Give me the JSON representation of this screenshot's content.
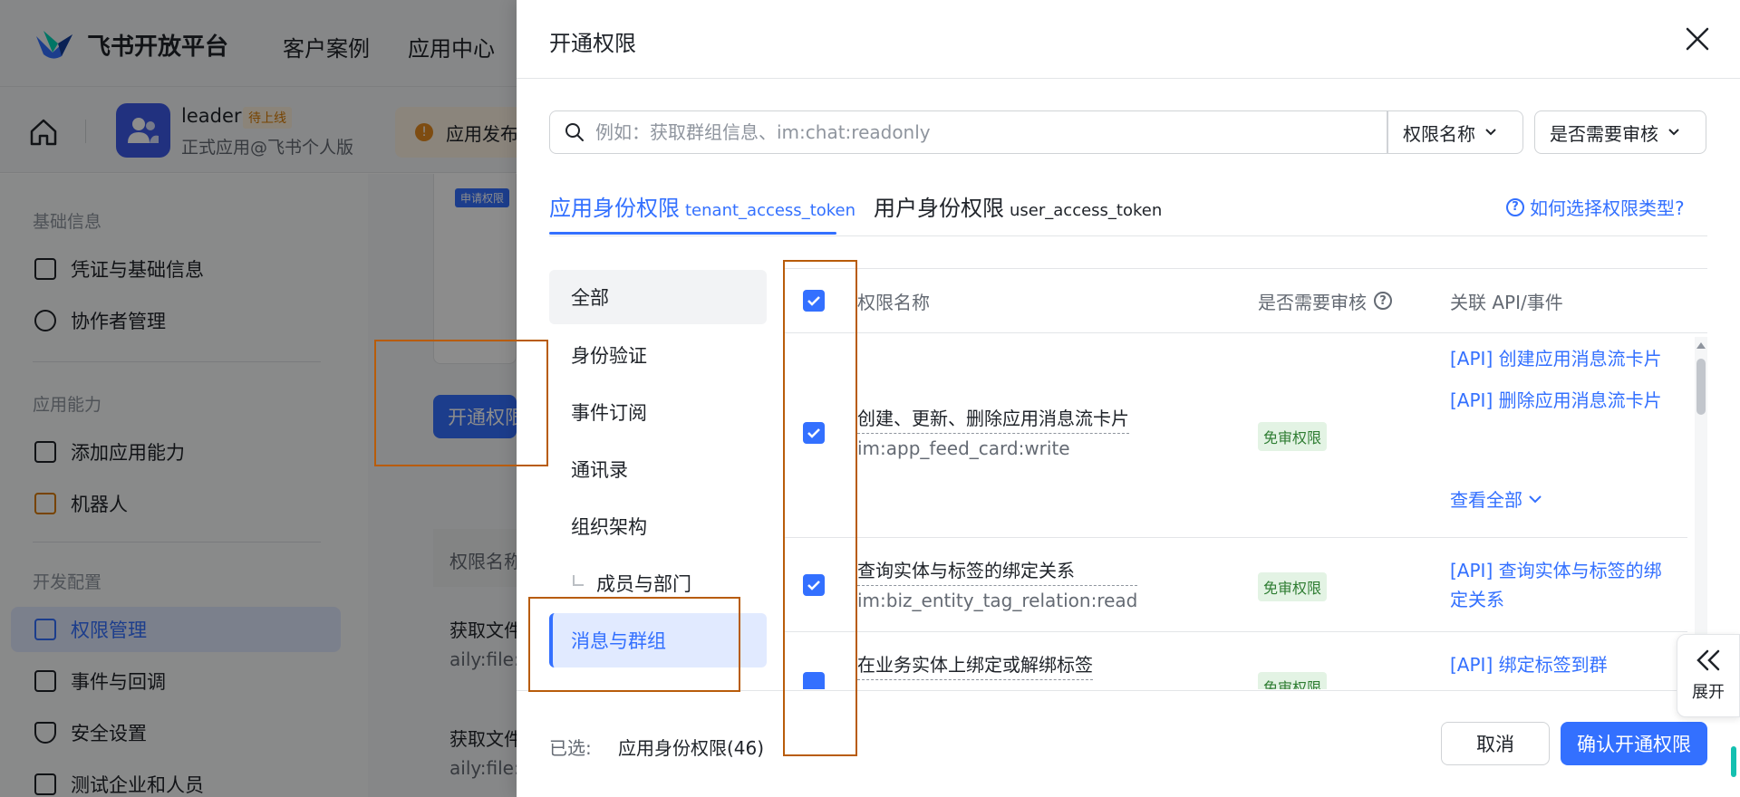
{
  "header": {
    "logo_text": "飞书开放平台",
    "nav": [
      "客户案例",
      "应用中心"
    ]
  },
  "app": {
    "name": "leader",
    "badge": "待上线",
    "subtitle": "正式应用@飞书个人版",
    "notice": "应用发布"
  },
  "sidebar": {
    "sections": [
      {
        "title": "基础信息",
        "items": [
          "凭证与基础信息",
          "协作者管理"
        ]
      },
      {
        "title": "应用能力",
        "items": [
          "添加应用能力",
          "机器人"
        ]
      },
      {
        "title": "开发配置",
        "items": [
          "权限管理",
          "事件与回调",
          "安全设置",
          "测试企业和人员"
        ]
      }
    ],
    "active_item": "权限管理"
  },
  "main": {
    "apply_badge": "申请权限",
    "open_button": "开通权限",
    "table_header": "权限名称",
    "rows": [
      {
        "name": "获取文件",
        "code": "aily:file:"
      },
      {
        "name": "获取文件",
        "code": "aily:file:"
      }
    ]
  },
  "drawer": {
    "title": "开通权限",
    "search_placeholder": "例如：获取群组信息、im:chat:readonly",
    "filter_name": "权限名称",
    "filter_review": "是否需要审核",
    "tabs": [
      {
        "label": "应用身份权限",
        "token": "tenant_access_token",
        "active": true
      },
      {
        "label": "用户身份权限",
        "token": "user_access_token",
        "active": false
      }
    ],
    "help_link": "如何选择权限类型?",
    "categories": [
      "全部",
      "身份验证",
      "事件订阅",
      "通讯录",
      "组织架构",
      "成员与部门",
      "消息与群组"
    ],
    "selected_category": "消息与群组",
    "table": {
      "columns": [
        "权限名称",
        "是否需要审核",
        "关联 API/事件"
      ],
      "rows": [
        {
          "title": "创建、更新、删除应用消息流卡片",
          "code": "im:app_feed_card:write",
          "tag": "免审权限",
          "apis": [
            "[API] 创建应用消息流卡片",
            "[API] 删除应用消息流卡片"
          ],
          "more": "查看全部"
        },
        {
          "title": "查询实体与标签的绑定关系",
          "code": "im:biz_entity_tag_relation:read",
          "tag": "免审权限",
          "apis": [
            "[API] 查询实体与标签的绑定关系"
          ]
        },
        {
          "title": "在业务实体上绑定或解绑标签",
          "code": "",
          "tag": "免审权限",
          "apis": [
            "[API] 绑定标签到群"
          ]
        }
      ]
    },
    "footer": {
      "selected_label": "已选:",
      "selected_value": "应用身份权限(46)",
      "cancel": "取消",
      "confirm": "确认开通权限"
    },
    "expand_label": "展开"
  },
  "colors": {
    "accent": "#3370ff",
    "annotation": "#b85c0a",
    "tag_bg": "#e3f3e4",
    "tag_text": "#2e7d32"
  }
}
